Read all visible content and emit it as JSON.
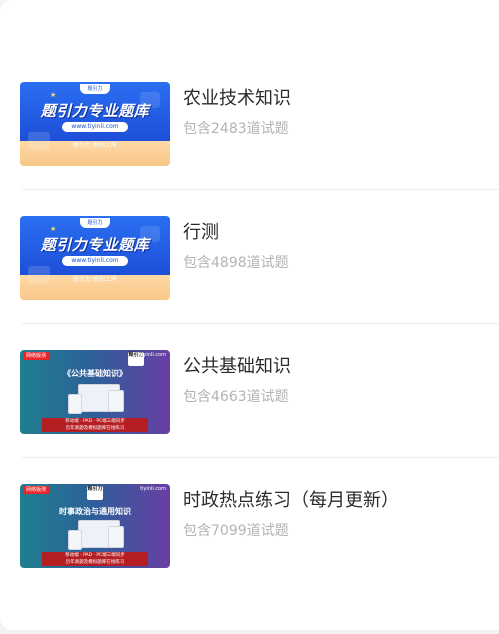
{
  "items": [
    {
      "title": "农业技术知识",
      "subtitle": "包含2483道试题",
      "thumb": {
        "style": "blue",
        "logo": "题引力",
        "headline": "题引力专业题库",
        "url": "www.tiyinli.com",
        "tagline": "题引力 助你上岸"
      }
    },
    {
      "title": "行测",
      "subtitle": "包含4898道试题",
      "thumb": {
        "style": "blue",
        "logo": "题引力",
        "headline": "题引力专业题库",
        "url": "www.tiyinli.com",
        "tagline": "题引力 助你上岸"
      }
    },
    {
      "title": "公共基础知识",
      "subtitle": "包含4663道试题",
      "thumb": {
        "style": "gradient",
        "badge": "网络版测",
        "domain": "tiyinli.com",
        "brand": "题引力",
        "caption": "《公共基础知识》",
        "bar_line1": "移动端 · PAD · PC端三端同步",
        "bar_line2": "历年真题及模拟题库在线练习"
      }
    },
    {
      "title": "时政热点练习（每月更新）",
      "subtitle": "包含7099道试题",
      "thumb": {
        "style": "gradient",
        "badge": "网络版测",
        "domain": "tiyinli.com",
        "brand": "题引力",
        "caption": "时事政治与通用知识",
        "bar_line1": "移动端 · PAD · PC端三端同步",
        "bar_line2": "历年真题及模拟题库在线练习"
      }
    }
  ],
  "colors": {
    "title": "#2b2b2b",
    "subtitle": "#b3b3b3",
    "divider": "#eeeeee",
    "blue_brand": "#1d4fd8",
    "red_badge": "#e8262a"
  }
}
